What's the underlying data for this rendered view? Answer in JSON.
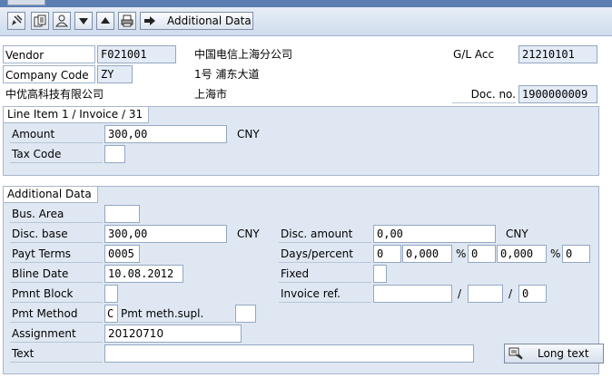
{
  "toolbar": {
    "buttons": [
      "edit-icon",
      "documents-icon",
      "person-icon",
      "arrow-down-icon",
      "arrow-up-icon",
      "print-icon"
    ],
    "additional_data_label": "Additional Data"
  },
  "header": {
    "vendor_label": "Vendor",
    "vendor_value": "F021001",
    "vendor_name": "中国电信上海分公司",
    "company_code_label": "Company Code",
    "company_code_value": "ZY",
    "vendor_street": "1号 浦东大道",
    "company_name": "中优高科技有限公司",
    "vendor_city": "上海市",
    "gl_acc_label": "G/L Acc",
    "gl_acc_value": "21210101",
    "doc_no_label": "Doc. no.",
    "doc_no_value": "1900000009"
  },
  "line_item": {
    "title": "Line Item 1 / Invoice / 31",
    "amount_label": "Amount",
    "amount_value": "300,00",
    "currency": "CNY",
    "tax_code_label": "Tax Code",
    "tax_code_value": ""
  },
  "additional": {
    "title": "Additional Data",
    "bus_area_label": "Bus. Area",
    "bus_area_value": "",
    "disc_base_label": "Disc. base",
    "disc_base_value": "300,00",
    "disc_base_currency": "CNY",
    "disc_amount_label": "Disc. amount",
    "disc_amount_value": "0,00",
    "disc_amount_currency": "CNY",
    "payt_terms_label": "Payt Terms",
    "payt_terms_value": "0005",
    "days_percent_label": "Days/percent",
    "days1": "0",
    "pct1": "0,000",
    "pct_sign1": "%",
    "days2": "0",
    "pct2": "0,000",
    "pct_sign2": "%",
    "days3": "0",
    "bline_date_label": "Bline Date",
    "bline_date_value": "10.08.2012",
    "fixed_label": "Fixed",
    "fixed_value": "",
    "pmnt_block_label": "Pmnt Block",
    "pmnt_block_value": "",
    "invoice_ref_label": "Invoice ref.",
    "invoice_ref_1": "",
    "slash1": "/",
    "invoice_ref_2": "",
    "slash2": "/",
    "invoice_ref_3": "0",
    "pmt_method_label": "Pmt Method",
    "pmt_method_value": "C",
    "pmt_meth_supl_label": "Pmt meth.supl.",
    "pmt_meth_supl_value": "",
    "assignment_label": "Assignment",
    "assignment_value": "20120710",
    "text_label": "Text",
    "text_value": "",
    "long_text_label": "Long text"
  }
}
